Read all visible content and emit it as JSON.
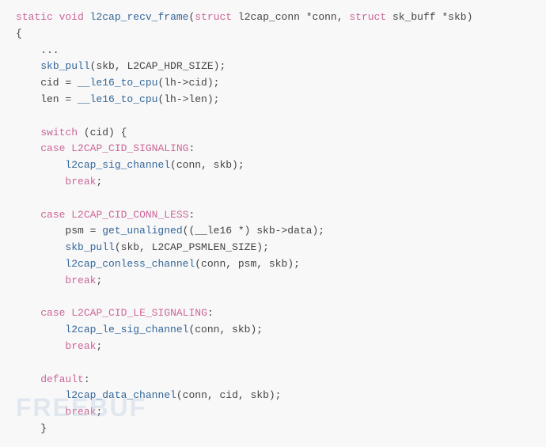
{
  "code": {
    "title": "l2cap_recv_frame function",
    "lines": [
      {
        "id": 1,
        "type": "signature"
      },
      {
        "id": 2,
        "type": "open_brace"
      },
      {
        "id": 3,
        "type": "ellipsis"
      },
      {
        "id": 4,
        "type": "skb_pull"
      },
      {
        "id": 5,
        "type": "cid_assign"
      },
      {
        "id": 6,
        "type": "len_assign"
      },
      {
        "id": 7,
        "type": "blank"
      },
      {
        "id": 8,
        "type": "switch"
      },
      {
        "id": 9,
        "type": "case_signaling"
      },
      {
        "id": 10,
        "type": "sig_channel"
      },
      {
        "id": 11,
        "type": "break1"
      },
      {
        "id": 12,
        "type": "blank"
      },
      {
        "id": 13,
        "type": "case_conn_less"
      },
      {
        "id": 14,
        "type": "psm_assign"
      },
      {
        "id": 15,
        "type": "skb_pull2"
      },
      {
        "id": 16,
        "type": "conless_channel"
      },
      {
        "id": 17,
        "type": "break2"
      },
      {
        "id": 18,
        "type": "blank"
      },
      {
        "id": 19,
        "type": "case_le_signaling"
      },
      {
        "id": 20,
        "type": "le_sig_channel"
      },
      {
        "id": 21,
        "type": "break3"
      },
      {
        "id": 22,
        "type": "blank"
      },
      {
        "id": 23,
        "type": "default"
      },
      {
        "id": 24,
        "type": "data_channel"
      },
      {
        "id": 25,
        "type": "break4"
      },
      {
        "id": 26,
        "type": "close_brace"
      }
    ]
  },
  "watermark": "FREEBUF"
}
